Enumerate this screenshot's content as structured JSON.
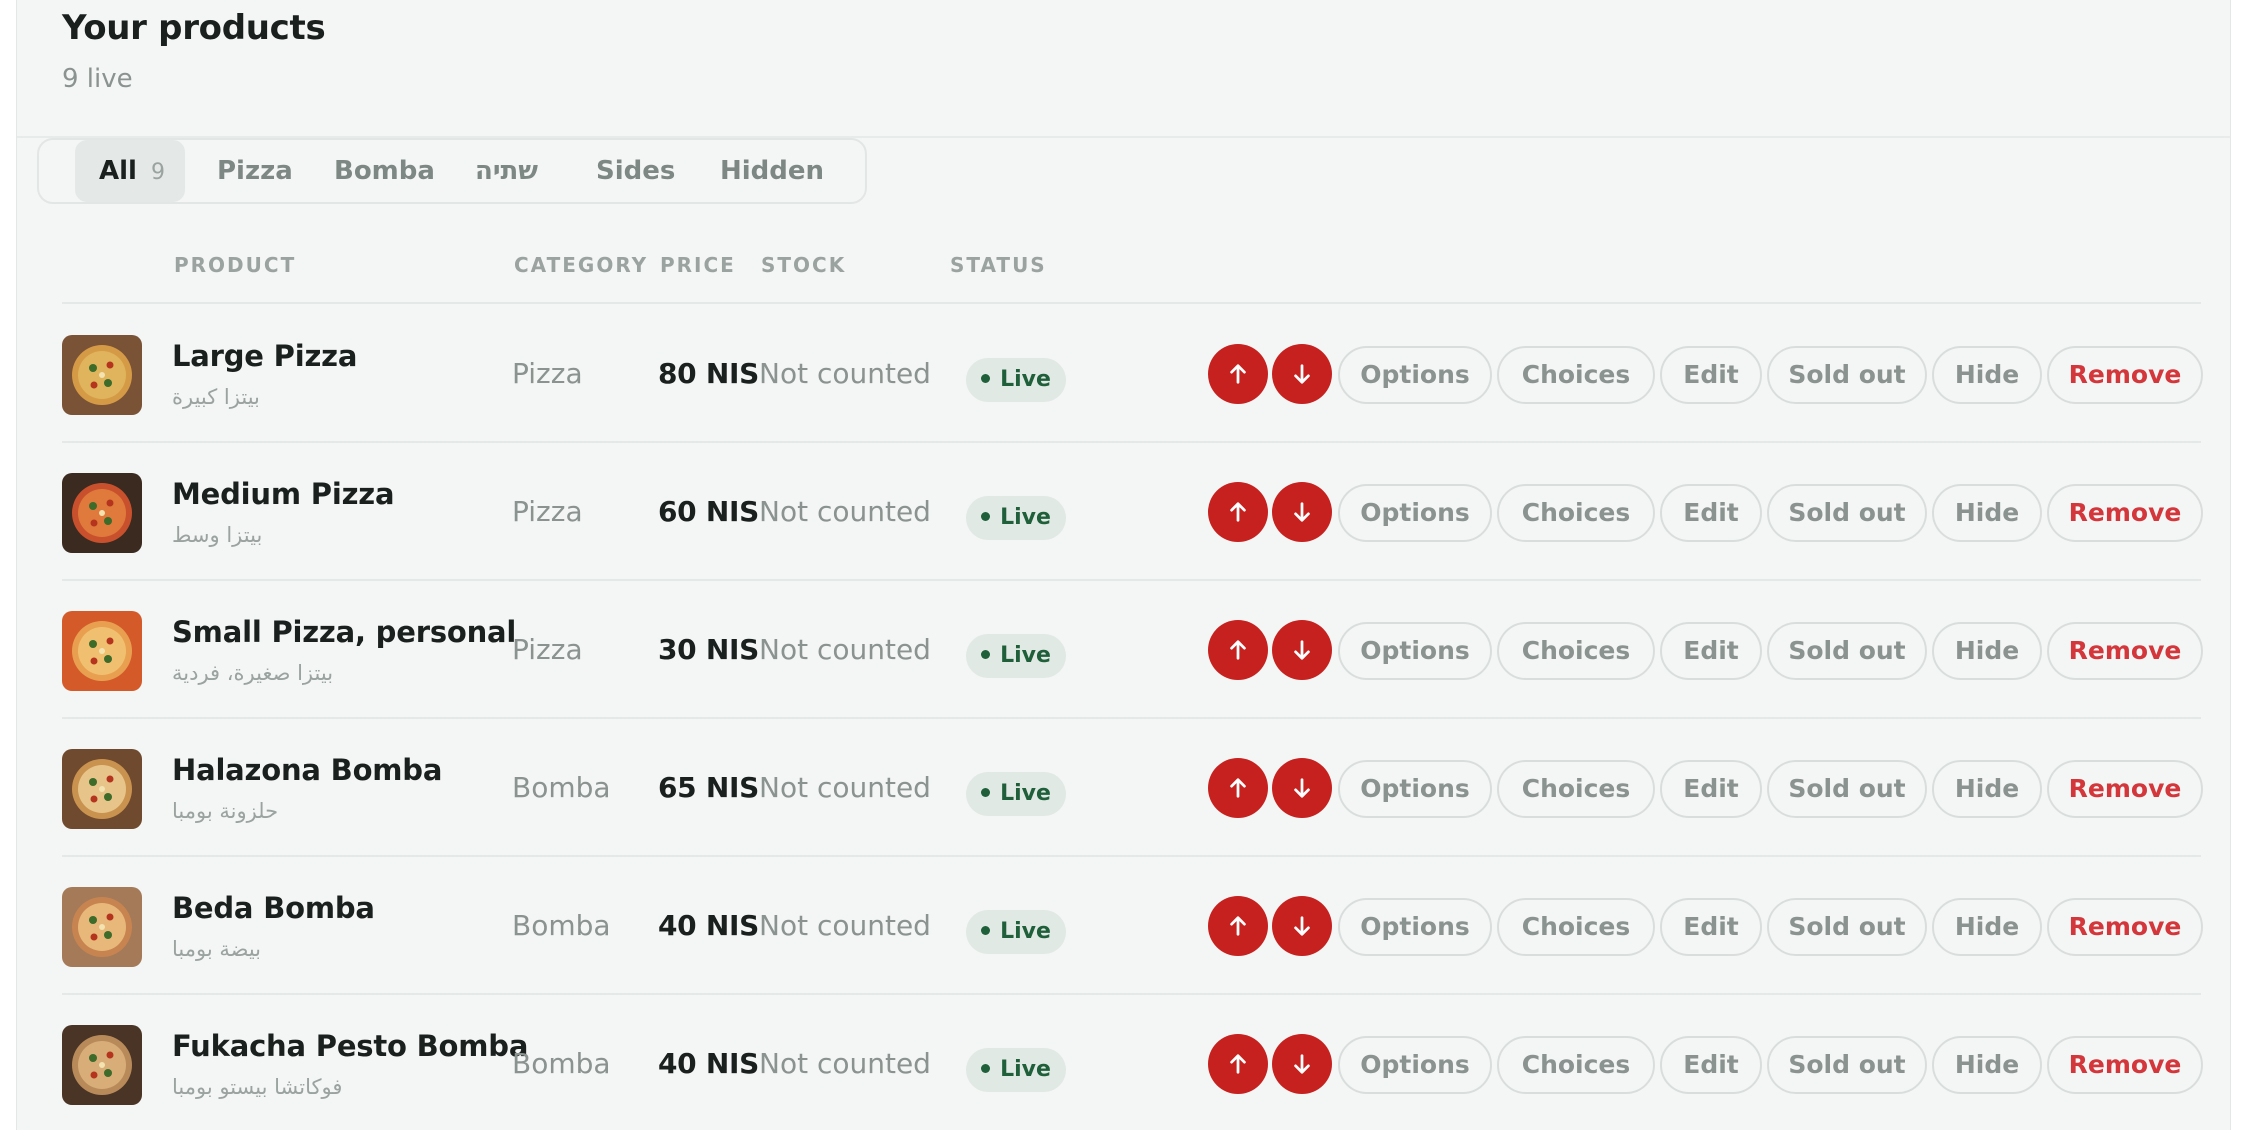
{
  "header": {
    "title": "Your products",
    "subtitle": "9 live"
  },
  "tabs": [
    {
      "label": "All",
      "count": "9",
      "active": true
    },
    {
      "label": "Pizza"
    },
    {
      "label": "Bomba"
    },
    {
      "label": "שתיה"
    },
    {
      "label": "Sides"
    },
    {
      "label": "Hidden"
    }
  ],
  "columns": {
    "product": "PRODUCT",
    "category": "CATEGORY",
    "price": "PRICE",
    "stock": "STOCK",
    "status": "STATUS"
  },
  "actions": {
    "options": "Options",
    "choices": "Choices",
    "edit": "Edit",
    "sold_out": "Sold out",
    "hide": "Hide",
    "remove": "Remove"
  },
  "colors": {
    "accent_red": "#c6211f",
    "live_badge": "#e0e9e4",
    "live_text": "#1f5f3a",
    "remove_text": "#d3363b"
  },
  "products": [
    {
      "name": "Large Pizza",
      "alt_name": "بيتزا كبيرة",
      "category": "Pizza",
      "price": "80 NIS",
      "stock": "Not counted",
      "status": "Live"
    },
    {
      "name": "Medium Pizza",
      "alt_name": "بيتزا وسط",
      "category": "Pizza",
      "price": "60 NIS",
      "stock": "Not counted",
      "status": "Live"
    },
    {
      "name": "Small Pizza, personal",
      "alt_name": "بيتزا صغيرة، فردية",
      "category": "Pizza",
      "price": "30 NIS",
      "stock": "Not counted",
      "status": "Live"
    },
    {
      "name": "Halazona Bomba",
      "alt_name": "حلزونة بومبا",
      "category": "Bomba",
      "price": "65 NIS",
      "stock": "Not counted",
      "status": "Live"
    },
    {
      "name": "Beda Bomba",
      "alt_name": "بيضة بومبا",
      "category": "Bomba",
      "price": "40 NIS",
      "stock": "Not counted",
      "status": "Live"
    },
    {
      "name": "Fukacha Pesto Bomba",
      "alt_name": "فوكاتشا بيستو بومبا",
      "category": "Bomba",
      "price": "40 NIS",
      "stock": "Not counted",
      "status": "Live"
    }
  ]
}
